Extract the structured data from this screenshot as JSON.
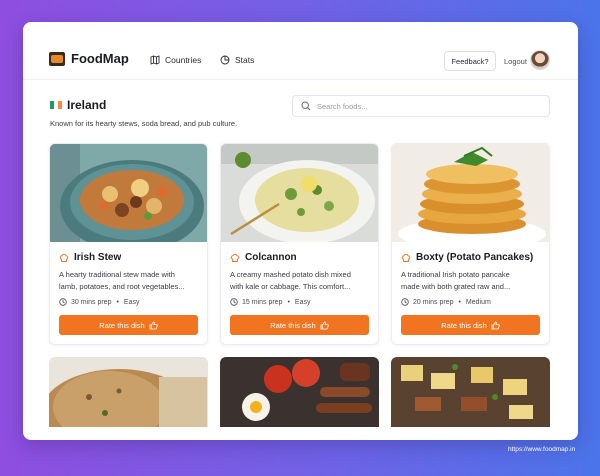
{
  "app": {
    "name": "FoodMap"
  },
  "nav": {
    "countries": "Countries",
    "stats": "Stats"
  },
  "header": {
    "feedback": "Feedback?",
    "logout": "Logout"
  },
  "country": {
    "flag_colors": [
      "#169b62",
      "#ffffff",
      "#ff883e"
    ],
    "name": "Ireland",
    "description": "Known for its hearty stews, soda bread, and pub culture."
  },
  "search": {
    "placeholder": "Search foods...",
    "value": ""
  },
  "dishes": [
    {
      "name": "Irish Stew",
      "desc_line1": "A hearty traditional stew made with",
      "desc_line2": "lamb, potatoes, and root vegetables...",
      "prep": "30 mins prep",
      "difficulty": "Easy",
      "button": "Rate this dish"
    },
    {
      "name": "Colcannon",
      "desc_line1": "A creamy mashed potato dish mixed",
      "desc_line2": "with kale or cabbage. This comfort...",
      "prep": "15 mins prep",
      "difficulty": "Easy",
      "button": "Rate this dish"
    },
    {
      "name": "Boxty (Potato Pancakes)",
      "desc_line1": "A traditional Irish potato pancake",
      "desc_line2": "made with both grated raw and...",
      "prep": "20 mins prep",
      "difficulty": "Medium",
      "button": "Rate this dish"
    }
  ],
  "colors": {
    "accent": "#f17421",
    "chef_icon": "#f17421"
  },
  "footer": {
    "url": "https://www.foodmap.in"
  }
}
